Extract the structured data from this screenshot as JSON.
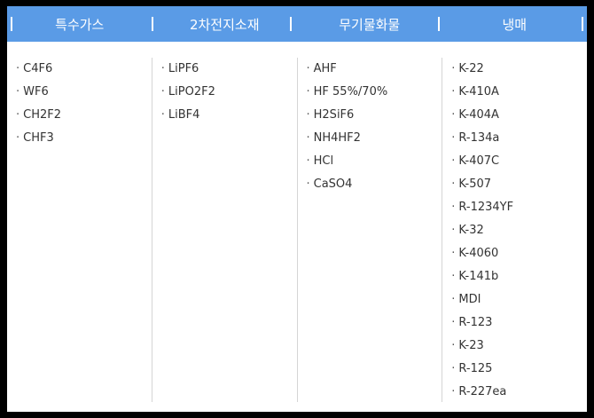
{
  "accent_color": "#5a9be6",
  "tabs": [
    {
      "label": "특수가스"
    },
    {
      "label": "2차전지소재"
    },
    {
      "label": "무기물화물"
    },
    {
      "label": "냉매"
    }
  ],
  "bullet": "·",
  "columns": [
    {
      "items": [
        "C4F6",
        "WF6",
        "CH2F2",
        "CHF3"
      ]
    },
    {
      "items": [
        "LiPF6",
        "LiPO2F2",
        "LiBF4"
      ]
    },
    {
      "items": [
        "AHF",
        "HF 55%/70%",
        "H2SiF6",
        "NH4HF2",
        "HCl",
        "CaSO4"
      ]
    },
    {
      "items": [
        "K-22",
        "K-410A",
        "K-404A",
        "R-134a",
        "K-407C",
        "K-507",
        "R-1234YF",
        "K-32",
        "K-4060",
        "K-141b",
        "MDI",
        "R-123",
        "K-23",
        "R-125",
        "R-227ea"
      ]
    }
  ]
}
